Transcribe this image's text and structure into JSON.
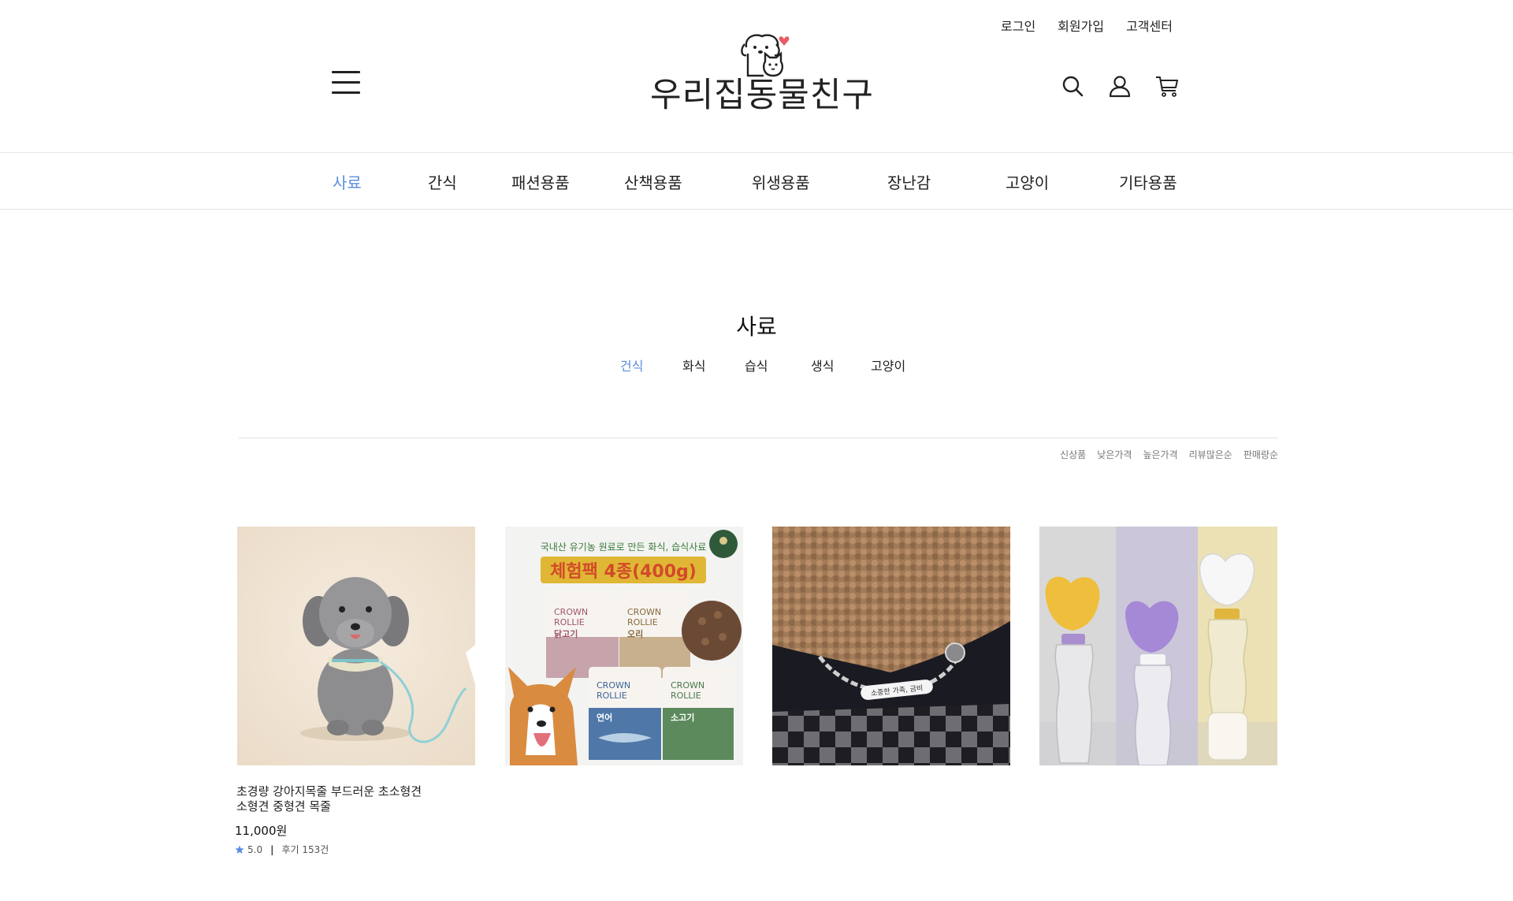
{
  "header": {
    "top_links": [
      "로그인",
      "회원가입",
      "고객센터"
    ],
    "logo_text": "우리집동물친구",
    "icons": [
      "menu-icon",
      "search-icon",
      "user-icon",
      "cart-icon"
    ]
  },
  "gnb": [
    {
      "label": "사료",
      "active": true
    },
    {
      "label": "간식",
      "active": false
    },
    {
      "label": "패션용품",
      "active": false
    },
    {
      "label": "산책용품",
      "active": false
    },
    {
      "label": "위생용품",
      "active": false
    },
    {
      "label": "장난감",
      "active": false
    },
    {
      "label": "고양이",
      "active": false
    },
    {
      "label": "기타용품",
      "active": false
    }
  ],
  "category": {
    "title": "사료",
    "subcategories": [
      {
        "label": "건식",
        "active": true
      },
      {
        "label": "화식",
        "active": false
      },
      {
        "label": "습식",
        "active": false
      },
      {
        "label": "생식",
        "active": false
      },
      {
        "label": "고양이",
        "active": false
      }
    ]
  },
  "sort_options": [
    "신상품",
    "낮은가격",
    "높은가격",
    "리뷰많은순",
    "판매량순"
  ],
  "food_pack": {
    "headline": "국내산 유기농 원료로 만든 화식, 습식사료",
    "badge": "체험팩 4종(400g)",
    "bags": [
      {
        "brand_line1": "CROWN",
        "brand_line2": "ROLLIE",
        "flavor": "닭고기"
      },
      {
        "brand_line1": "CROWN",
        "brand_line2": "ROLLIE",
        "flavor": "오리"
      },
      {
        "brand_line1": "CROWN",
        "brand_line2": "ROLLIE",
        "flavor": "연어"
      },
      {
        "brand_line1": "CROWN",
        "brand_line2": "ROLLIE",
        "flavor": "소고기"
      }
    ]
  },
  "collar_tag": "소중한 가족, 금비",
  "products": [
    {
      "name_line1": "초경량 강아지목줄 부드러운 초소형견",
      "name_line2": "소형견 중형견 목줄",
      "price": "11,000원",
      "rating": "5.0",
      "reviews": "후기 153건"
    }
  ],
  "colors": {
    "accent": "#5b8ee0",
    "text": "#222222",
    "border": "#e6e6e6"
  }
}
